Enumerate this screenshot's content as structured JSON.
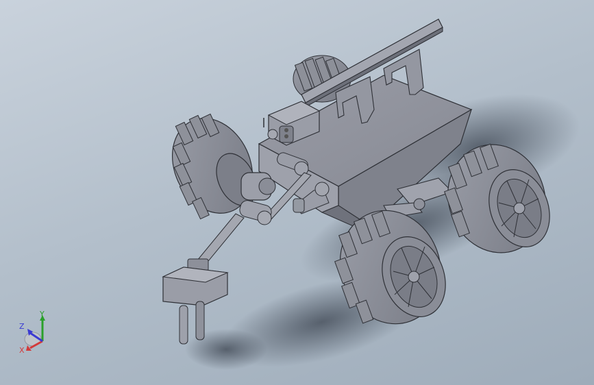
{
  "viewport": {
    "background_top": "#c9d2dc",
    "background_bottom": "#9eacba",
    "model_color": "#8c8f98",
    "model_edge": "#2e3036"
  },
  "triad": {
    "x_label": "X",
    "y_label": "Y",
    "z_label": "Z",
    "x_color": "#d23a3a",
    "y_color": "#2aa02a",
    "z_color": "#3a3ad2"
  }
}
